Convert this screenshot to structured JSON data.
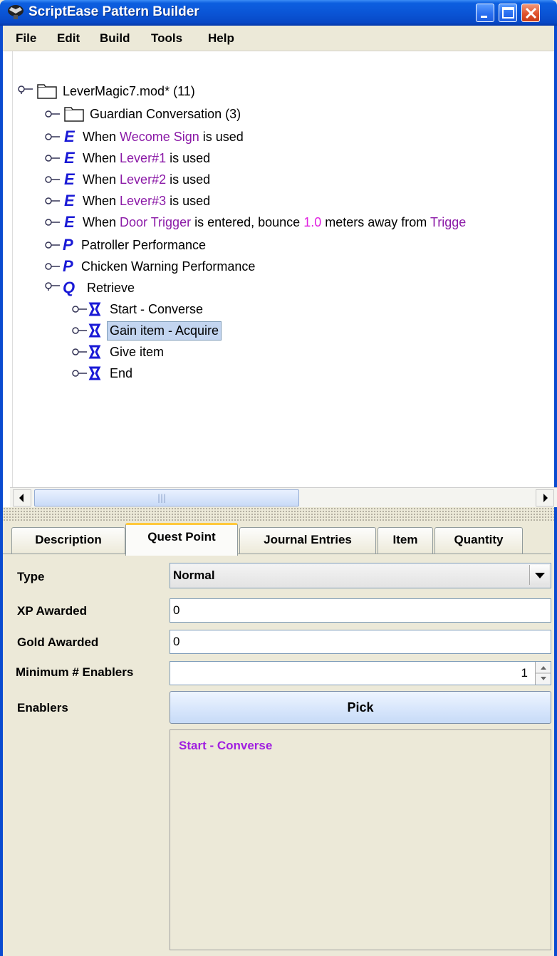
{
  "window": {
    "title": "ScriptEase Pattern Builder"
  },
  "menu": {
    "items": [
      "File",
      "Edit",
      "Build",
      "Tools",
      "Help"
    ]
  },
  "tree": {
    "root": "LeverMagic7.mod* (11)",
    "rows": [
      {
        "prefix": "Guardian Conversation (3)"
      },
      {
        "prefix": "When ",
        "ref": "Wecome Sign",
        "suffix": " is used"
      },
      {
        "prefix": "When ",
        "ref": "Lever#1",
        "suffix": " is used"
      },
      {
        "prefix": "When ",
        "ref": "Lever#2",
        "suffix": " is used"
      },
      {
        "prefix": "When ",
        "ref": "Lever#3",
        "suffix": " is used"
      },
      {
        "prefix": "When ",
        "ref": "Door Trigger",
        "mid": " is entered, bounce ",
        "num": "1.0",
        "mid2": " meters away from ",
        "ref2": "Trigge"
      },
      {
        "prefix": "Patroller Performance"
      },
      {
        "prefix": "Chicken Warning Performance"
      },
      {
        "prefix": "Retrieve"
      },
      {
        "prefix": "Start - Converse"
      },
      {
        "prefix": "Gain item - Acquire"
      },
      {
        "prefix": "Give item"
      },
      {
        "prefix": "End"
      }
    ],
    "icons": {
      "event": "E",
      "performance": "P",
      "quest": "Q"
    }
  },
  "scrollbar": {
    "grip": "|||"
  },
  "tabs": [
    "Description",
    "Quest Point",
    "Journal Entries",
    "Item",
    "Quantity"
  ],
  "form": {
    "type_label": "Type",
    "type_value": "Normal",
    "xp_label": "XP Awarded",
    "xp_value": "0",
    "gold_label": "Gold Awarded",
    "gold_value": "0",
    "min_enablers_label": "Minimum # Enablers",
    "min_enablers_value": "1",
    "enablers_label": "Enablers",
    "pick_label": "Pick",
    "enablers": [
      "Start - Converse"
    ]
  },
  "colors": {
    "ref": "#8b1aa7",
    "number": "#e020e0",
    "icon_blue": "#1a1ad6",
    "titlebar": "#0a55d6"
  }
}
